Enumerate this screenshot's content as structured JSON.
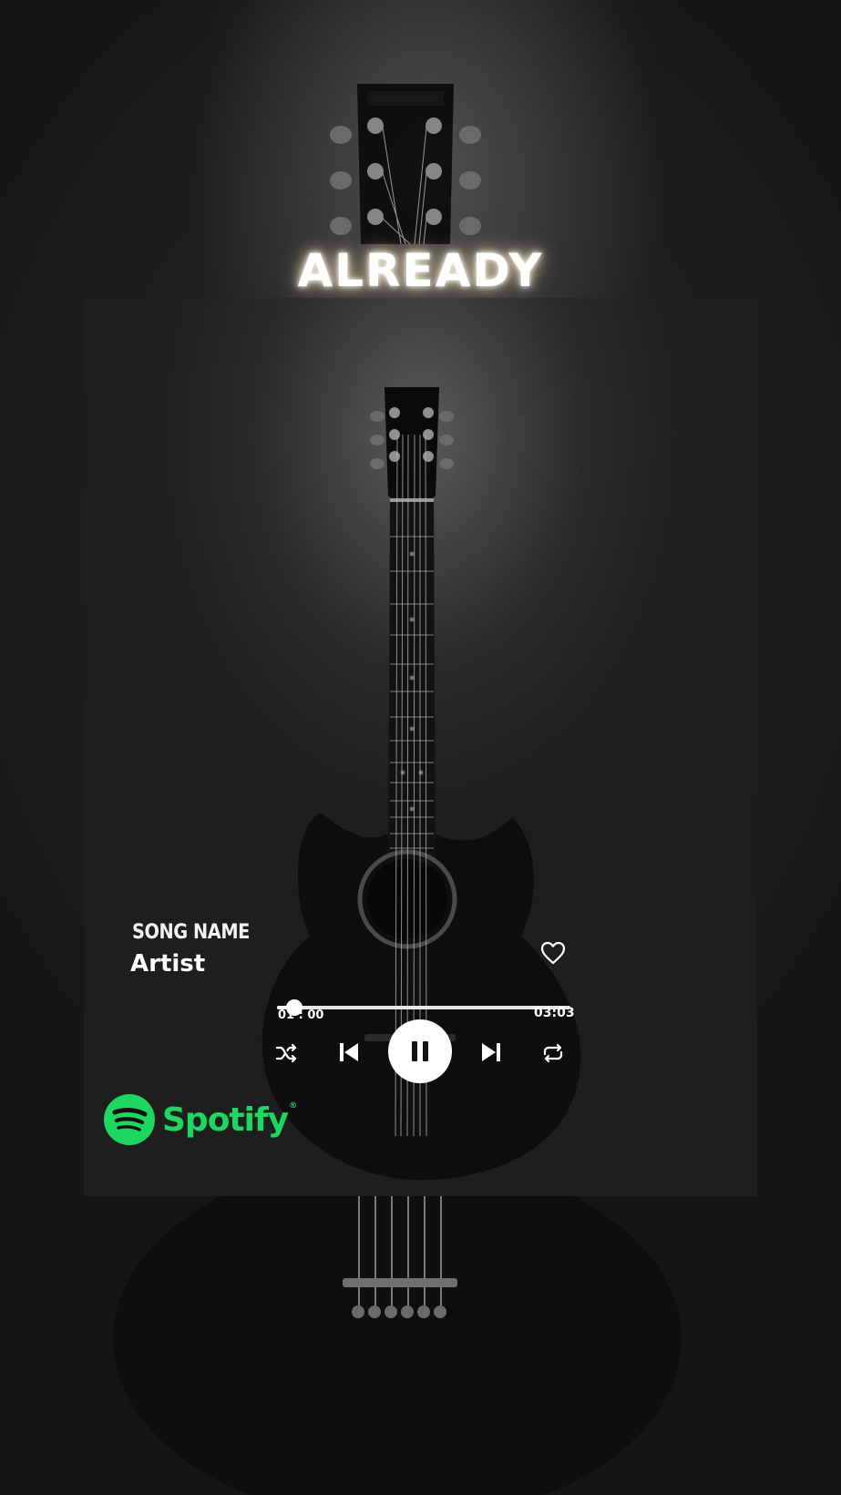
{
  "poster": {
    "headline": "ALREADY"
  },
  "player": {
    "song_title": "SONG NAME",
    "artist": "Artist",
    "time_current": "01 : 00",
    "time_total": "03:03",
    "progress_fraction": 0.06,
    "state": "playing",
    "liked": false,
    "icons": {
      "like": "heart-outline-icon",
      "shuffle": "shuffle-icon",
      "previous": "skip-previous-icon",
      "play_pause": "pause-icon",
      "next": "skip-next-icon",
      "repeat": "repeat-icon"
    }
  },
  "brand": {
    "name": "Spotify",
    "trademark": "®",
    "icon": "spotify-logo-icon",
    "color": "#1ed760"
  },
  "colors": {
    "background": "#141414",
    "text": "#ffffff",
    "glow": "#ffe8c8"
  }
}
